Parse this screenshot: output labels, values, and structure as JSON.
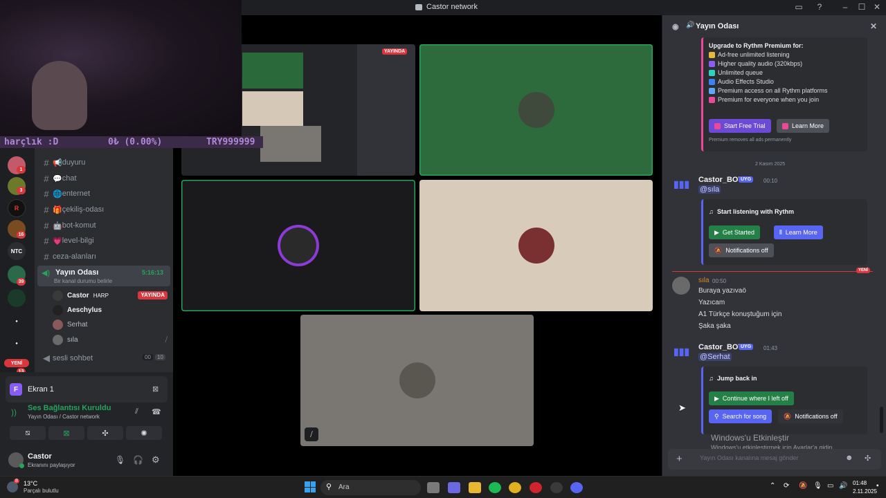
{
  "window": {
    "title": "Castor network"
  },
  "overlay": {
    "left": "harçlık :D",
    "mid": "0₺ (0.00%)",
    "right": "TRY999999"
  },
  "servers": {
    "badges": [
      "1",
      "3",
      "16",
      "39",
      "13"
    ],
    "ntc": "NTC",
    "new": "YENİ"
  },
  "channels": [
    {
      "icon": "📢",
      "name": "duyuru"
    },
    {
      "icon": "💬",
      "name": "chat"
    },
    {
      "icon": "🌐",
      "name": "enternet"
    },
    {
      "icon": "🎁",
      "name": "çekiliş-odası"
    },
    {
      "icon": "🤖",
      "name": "bot-komut"
    },
    {
      "icon": "💗",
      "name": "level-bilgi"
    },
    {
      "icon": "",
      "name": "ceza-alanları"
    }
  ],
  "voice": {
    "name": "Yayın Odası",
    "timer": "5:16:13",
    "status": "Bir kanal durumu belirle",
    "users": [
      {
        "name": "Castor",
        "tag": "HARP",
        "live": "YAYINDA"
      },
      {
        "name": "Aeschylus"
      },
      {
        "name": "Serhat"
      },
      {
        "name": "sıla"
      }
    ],
    "other": {
      "name": "sesli sohbet",
      "count1": "00",
      "count2": "10"
    }
  },
  "panel": {
    "screen_title": "Ekran 1",
    "conn_status": "Ses Bağlantısı Kuruldu",
    "conn_sub": "Yayın Odası / Castor network",
    "user": "Castor",
    "user_status": "Ekranını paylaşıyor"
  },
  "stage": {
    "live_badge": "YAYINDA"
  },
  "chat": {
    "header": "Yayın Odası",
    "premium": {
      "title": "Upgrade to Rythm Premium for:",
      "items": [
        {
          "text": "Ad-free unlimited listening",
          "color": "#e6b93c"
        },
        {
          "text": "Higher quality audio (320kbps)",
          "color": "#8b5cf6"
        },
        {
          "text": "Unlimited queue",
          "color": "#2dd4bf"
        },
        {
          "text": "Audio Effects Studio",
          "color": "#3b82f6"
        },
        {
          "text": "Premium access on all Rythm platforms",
          "color": "#60a5fa"
        },
        {
          "text": "Premium for everyone when you join",
          "color": "#ec4899"
        }
      ],
      "trial": "Start Free Trial",
      "learn": "Learn More",
      "foot": "Premium removes all ads permanently"
    },
    "date_divider": "2 Kasım 2025",
    "bot1": {
      "name": "Castor_BOT",
      "app": "UYG",
      "time": "00:10",
      "mention": "@sıla",
      "embed_title": "Start listening with Rythm",
      "btn1": "Get Started",
      "btn2": "Learn More",
      "btn3": "Notifications off"
    },
    "new_label": "YENİ",
    "user_msg": {
      "name": "sıla",
      "time": "00:50",
      "lines": [
        "Buraya yazıvaö",
        "Yazıcam",
        "A1 Türkçe konuştuğum için",
        "Şaka şaka"
      ]
    },
    "bot2": {
      "name": "Castor_BOT",
      "app": "UYG",
      "time": "01:43",
      "mention": "@Serhat",
      "embed_title": "Jump back in",
      "btn1": "Continue where I left off",
      "btn2": "Search for song",
      "btn3": "Notifications off"
    },
    "input_placeholder": "Yayın Odası kanalına mesaj gönder"
  },
  "activation": {
    "title": "Windows'u Etkinleştir",
    "sub": "Windows'u etkinleştirmek için Ayarlar'a gidin."
  },
  "taskbar": {
    "weather_badge": "8",
    "temp": "13°C",
    "weather": "Parçalı bulutlu",
    "search": "Ara",
    "time": "01:48",
    "date": "2.11.2025"
  }
}
